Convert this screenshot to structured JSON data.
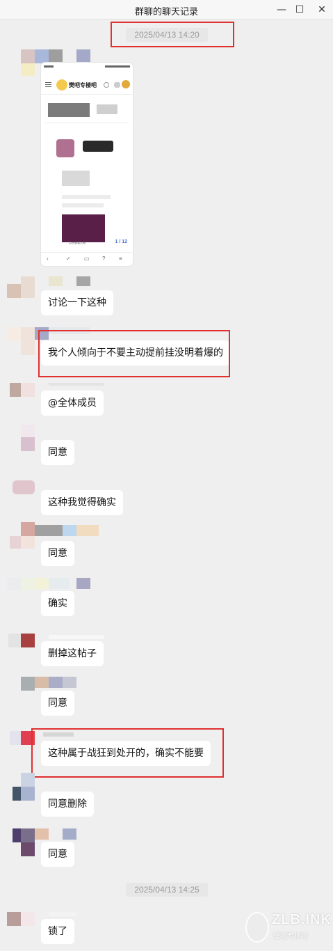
{
  "window": {
    "title": "群聊的聊天记录",
    "minimize_glyph": "—",
    "maximize_glyph": "☐",
    "close_glyph": "✕"
  },
  "timestamps": [
    "2025/04/13 14:20",
    "2025/04/13 14:25"
  ],
  "shared_image": {
    "app_name": "樊吧专楼吧",
    "page_indicator": "1 / 12",
    "caption": "点击查看大图"
  },
  "messages": [
    {
      "text": "讨论一下这种"
    },
    {
      "text": "我个人倾向于不要主动提前挂没明着爆的"
    },
    {
      "text": "@全体成员"
    },
    {
      "text": "同意"
    },
    {
      "text": "这种我觉得确实"
    },
    {
      "text": "同意"
    },
    {
      "text": "确实"
    },
    {
      "text": "删掉这帖子"
    },
    {
      "text": "同意"
    },
    {
      "text": "这种属于战狂到处开的，确实不能要"
    },
    {
      "text": "同意删除"
    },
    {
      "text": "同意"
    },
    {
      "text": "锁了"
    }
  ],
  "watermark": {
    "text": "ZLB.INK",
    "subtext": "壁吧专楼吧"
  },
  "colors": {
    "background": "#efefef",
    "bubble": "#ffffff",
    "highlight_box": "#e03030",
    "timestamp_text": "#9a9a9a"
  }
}
